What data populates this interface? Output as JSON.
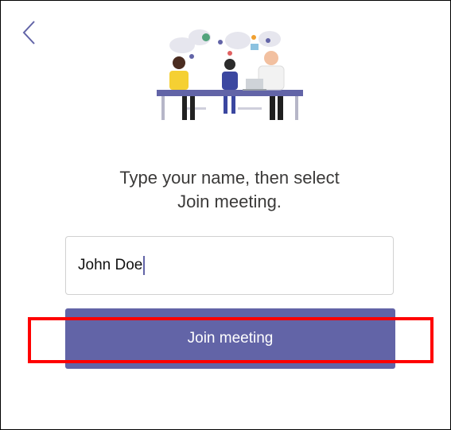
{
  "header": {
    "back_icon": "chevron-left-icon",
    "illustration_icon": "meeting-illustration"
  },
  "main": {
    "prompt_line1": "Type your name, then select",
    "prompt_line2": "Join meeting.",
    "name_field": {
      "value": "John Doe",
      "placeholder": ""
    },
    "join_button_label": "Join meeting"
  },
  "colors": {
    "accent": "#6264a7",
    "highlight": "#ff0000",
    "text": "#3b3a39"
  }
}
